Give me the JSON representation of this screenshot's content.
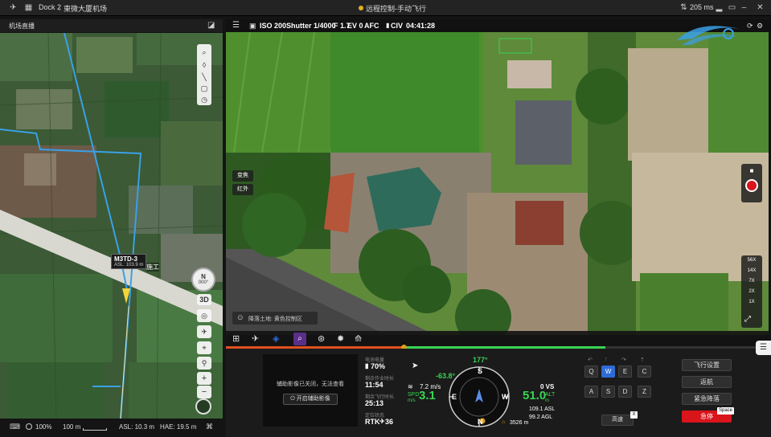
{
  "titlebar": {
    "app_name": "Dock 2",
    "separator": "|",
    "dock_name": "東微大厦机场",
    "mode": "远程控制-手动飞行",
    "latency": "205 ms"
  },
  "map_panel": {
    "title": "机场直播",
    "drone_label": "M3TD-3",
    "drone_asl": "ASL: 103.9 m",
    "building_label": "施工",
    "compass_dir": "N",
    "compass_deg": "000°",
    "btn_3d": "3D",
    "zoom_in": "+",
    "zoom_out": "−",
    "footer": {
      "zoom": "100%",
      "scale": "100 m",
      "asl": "ASL: 10.3 m",
      "hae": "HAE: 19.5 m"
    }
  },
  "camera": {
    "iso": "ISO 200",
    "shutter": "Shutter 1/4000",
    "fstop": "F 1.7",
    "ev": "EV 0",
    "afc": "AFC",
    "civ": "CIV",
    "rec_time": "04:41:28",
    "lens_zoom_label": "变焦",
    "lens_ir_label": "红外",
    "zoom_levels": [
      "56X",
      "14X",
      "7X",
      "2X",
      "1X"
    ],
    "notice": "降落土地: 黄色控制区"
  },
  "console": {
    "aux_video_off": "辅助影像已关闭，无法查看",
    "aux_video_btn": "开启辅助影像",
    "battery_label": "电池电量",
    "battery_val": "70%",
    "flight_time_label": "剩余作业时长",
    "flight_time_val": "11:54",
    "remaining_label": "剩余飞行时长",
    "remaining_val": "25:13",
    "rtk_label": "定位状态",
    "rtk_val": "RTK",
    "rtk_sats": "36",
    "heading": "177°",
    "pitch": "-63.8°",
    "wind": "7.2 m/s",
    "spd_label": "SPD",
    "spd_unit": "m/s",
    "spd_val": "3.1",
    "vs": "0 VS",
    "alt_val": "51.0",
    "alt_label": "ALT",
    "alt_unit": "m",
    "asl": "109.1 ASL",
    "agl": "99.2 AGL",
    "home_dist": "3526 m",
    "compass_letters": [
      "N",
      "E",
      "S",
      "W"
    ],
    "keys_row1": [
      "Q",
      "W",
      "E",
      "C"
    ],
    "keys_row2": [
      "A",
      "S",
      "D",
      "Z"
    ],
    "speed_btn": "高速",
    "speed_key": "X",
    "flight_settings": "飞行设置",
    "return_home": "返航",
    "emergency_land": "紧急降落",
    "hover": "急停",
    "hover_key": "Space"
  },
  "colors": {
    "accent_blue": "#2f6bd6",
    "stop_red": "#d9141b",
    "hud_green": "#39d353",
    "gold": "#d8a01c"
  }
}
